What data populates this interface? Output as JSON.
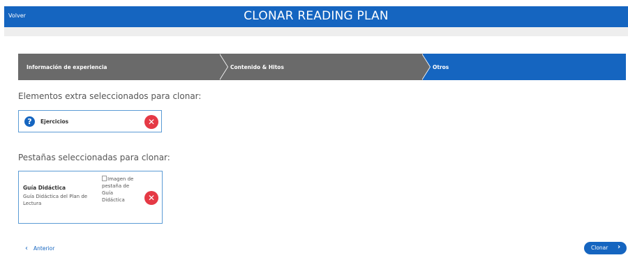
{
  "header": {
    "back_label": "Volver",
    "title": "CLONAR READING PLAN"
  },
  "stepper": {
    "steps": [
      {
        "label": "Información de experiencia",
        "active": false
      },
      {
        "label": "Contenido & Hitos",
        "active": false
      },
      {
        "label": "Otros",
        "active": true
      }
    ]
  },
  "extras": {
    "heading": "Elementos extra seleccionados para clonar:",
    "items": [
      {
        "icon": "question-icon",
        "label": "Ejercicios",
        "remove_icon": "close-icon"
      }
    ]
  },
  "tabs": {
    "heading": "Pestañas seleccionadas para clonar:",
    "items": [
      {
        "title": "Guía Didáctica",
        "description": "Guía Didáctica del Plan de Lectura",
        "image_alt": "Imagen de pestaña de Guía Didáctica",
        "remove_icon": "close-icon"
      }
    ]
  },
  "footer": {
    "prev_label": "Anterior",
    "clone_label": "Clonar"
  },
  "colors": {
    "primary": "#1565c0",
    "step_inactive": "#6a6a6a",
    "danger": "#e53945",
    "card_border": "#5b9bd5"
  }
}
